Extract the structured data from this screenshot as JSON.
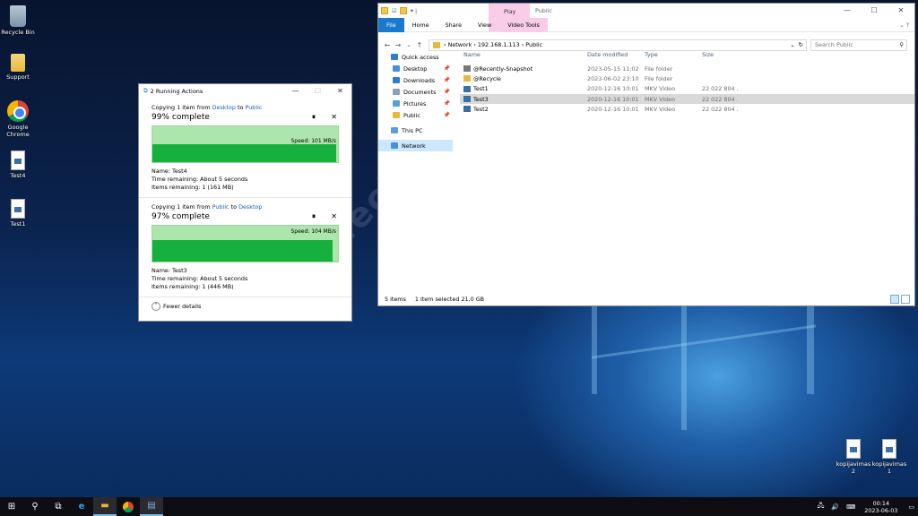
{
  "desktop": {
    "icons": [
      {
        "label": "Recycle Bin",
        "icon": "recycle-bin-icon"
      },
      {
        "label": "Support",
        "icon": "folder-icon"
      },
      {
        "label": "Google Chrome",
        "icon": "chrome-icon"
      },
      {
        "label": "Test4",
        "icon": "video-file-icon"
      },
      {
        "label": "Test1",
        "icon": "video-file-icon"
      },
      {
        "label": "kopijavimas 2",
        "icon": "file-icon"
      },
      {
        "label": "kopijavimas 1",
        "icon": "file-icon"
      }
    ],
    "watermark": "Tech",
    "watermark2": "geeks meet hardware and software",
    "watermark3": "ews.lt"
  },
  "copy_dialog": {
    "title": "2 Running Actions",
    "jobs": [
      {
        "prefix": "Copying 1 item from",
        "from": "Desktop",
        "to_word": "to",
        "to": "Public",
        "percent_text": "99% complete",
        "progress": 0.99,
        "speed": "Speed: 101 MB/s",
        "name": "Name:  Test4",
        "time": "Time remaining:  About 5 seconds",
        "items": "Items remaining:  1 (161 MB)"
      },
      {
        "prefix": "Copying 1 item from",
        "from": "Public",
        "to_word": "to",
        "to": "Desktop",
        "percent_text": "97% complete",
        "progress": 0.97,
        "speed": "Speed: 104 MB/s",
        "name": "Name:  Test3",
        "time": "Time remaining:  About 5 seconds",
        "items": "Items remaining:  1 (446 MB)"
      }
    ],
    "fewer_details": "Fewer details"
  },
  "explorer": {
    "title": "Public",
    "context_tab": "Play",
    "tabs": [
      "File",
      "Home",
      "Share",
      "View",
      "Video Tools"
    ],
    "breadcrumb": [
      "Network",
      "192.168.1.113",
      "Public"
    ],
    "search_placeholder": "Search Public",
    "nav": [
      {
        "label": "Quick access",
        "color": "#2f7bd6",
        "pin": false
      },
      {
        "label": "Desktop",
        "color": "#4a90d9",
        "pin": true
      },
      {
        "label": "Downloads",
        "color": "#2f7bd6",
        "pin": true
      },
      {
        "label": "Documents",
        "color": "#8aa0b8",
        "pin": true
      },
      {
        "label": "Pictures",
        "color": "#5aa0d8",
        "pin": true
      },
      {
        "label": "Public",
        "color": "#e8b83e",
        "pin": true
      },
      {
        "label": "This PC",
        "color": "#5aa0d8",
        "pin": false
      },
      {
        "label": "Network",
        "color": "#4a90d9",
        "pin": false
      }
    ],
    "columns": [
      "Name",
      "Date modified",
      "Type",
      "Size"
    ],
    "files": [
      {
        "name": "@Recently-Snapshot",
        "date": "2023-05-15 11:02",
        "type": "File folder",
        "size": "",
        "icon": "snapshot-folder-icon",
        "selected": false
      },
      {
        "name": "@Recycle",
        "date": "2023-06-02 23:10",
        "type": "File folder",
        "size": "",
        "icon": "folder-icon",
        "selected": false
      },
      {
        "name": "Test1",
        "date": "2020-12-16 10:01",
        "type": "MKV Video",
        "size": "22 022 804 ...",
        "icon": "video-file-icon",
        "selected": false
      },
      {
        "name": "Test3",
        "date": "2020-12-16 10:01",
        "type": "MKV Video",
        "size": "22 022 804 ...",
        "icon": "video-file-icon",
        "selected": true
      },
      {
        "name": "Test2",
        "date": "2020-12-16 10:01",
        "type": "MKV Video",
        "size": "22 022 804 ...",
        "icon": "video-file-icon",
        "selected": false
      }
    ],
    "status_items": "5 items",
    "status_selected": "1 item selected  21,0 GB"
  },
  "taskbar": {
    "time": "00:14",
    "date": "2023-06-03"
  }
}
